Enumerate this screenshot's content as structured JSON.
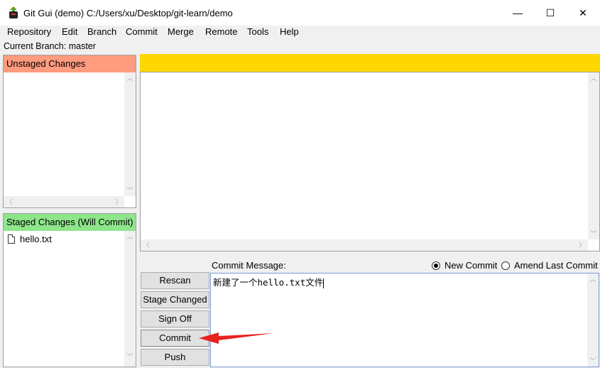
{
  "window": {
    "title": "Git Gui (demo) C:/Users/xu/Desktop/git-learn/demo",
    "minimize_glyph": "—",
    "maximize_glyph": "☐",
    "close_glyph": "✕"
  },
  "menu": {
    "items": [
      "Repository",
      "Edit",
      "Branch",
      "Commit",
      "Merge",
      "Remote",
      "Tools",
      "Help"
    ]
  },
  "branch": {
    "label": "Current Branch: master"
  },
  "unstaged": {
    "title": "Unstaged Changes",
    "color": "#ff9b7f"
  },
  "staged": {
    "title": "Staged Changes (Will Commit)",
    "color": "#8ee58a",
    "files": [
      "hello.txt"
    ]
  },
  "diff": {
    "header_color": "#ffd700"
  },
  "commit": {
    "message_label": "Commit Message:",
    "message_text": "新建了一个hello.txt文件",
    "mode_options": [
      "New Commit",
      "Amend Last Commit"
    ],
    "selected_mode": "New Commit"
  },
  "buttons": {
    "rescan": "Rescan",
    "stage_changed": "Stage Changed",
    "sign_off": "Sign Off",
    "commit": "Commit",
    "push": "Push"
  },
  "annotation": {
    "arrow_color": "#e8231f"
  }
}
